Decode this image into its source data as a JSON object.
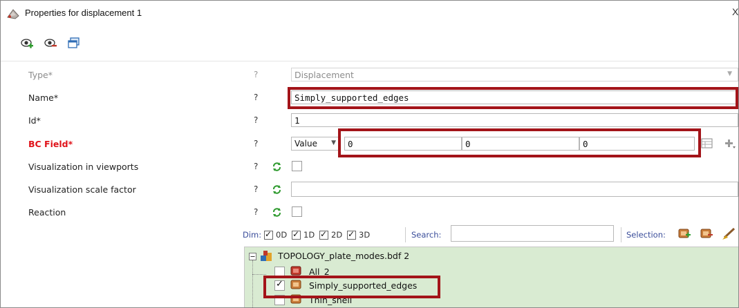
{
  "window": {
    "title": "Properties for displacement 1",
    "close_glyph": "X"
  },
  "toolbar": {
    "icons": [
      "show-eye-icon",
      "hide-eye-icon",
      "window-icon"
    ]
  },
  "form": {
    "help_glyph": "?",
    "type": {
      "label": "Type*",
      "value": "Displacement"
    },
    "name": {
      "label": "Name*",
      "value": "Simply_supported_edges"
    },
    "id": {
      "label": "Id*",
      "value": "1"
    },
    "bc_field": {
      "label": "BC Field*",
      "mode": "Value",
      "values": [
        "0",
        "0",
        "0"
      ]
    },
    "visualization": {
      "label": "Visualization in viewports",
      "checked": false
    },
    "scale": {
      "label": "Visualization scale factor",
      "value": ""
    },
    "reaction": {
      "label": "Reaction",
      "checked": false
    }
  },
  "filter": {
    "dim_label": "Dim:",
    "dims": [
      "0D",
      "1D",
      "2D",
      "3D"
    ],
    "search_label": "Search:",
    "search_value": "",
    "selection_label": "Selection:"
  },
  "tree": {
    "root": "TOPOLOGY_plate_modes.bdf 2",
    "items": [
      {
        "label": "All_2",
        "checked": false
      },
      {
        "label": "Simply_supported_edges",
        "checked": true
      },
      {
        "label": "Thin_shell",
        "checked": false
      }
    ]
  },
  "colors": {
    "required": "#e0131a",
    "highlight": "#a31419",
    "tree_bg": "#d9ebd2"
  }
}
